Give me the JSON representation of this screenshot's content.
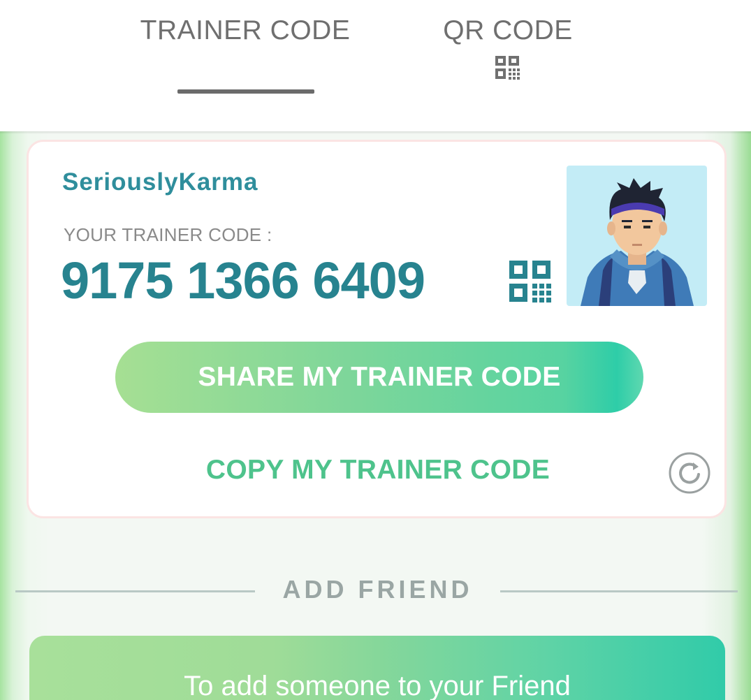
{
  "tabs": [
    {
      "label": "TRAINER CODE",
      "active": true
    },
    {
      "label": "QR CODE",
      "active": false,
      "icon": "qr-code-icon"
    }
  ],
  "trainer_card": {
    "trainer_name": "SeriouslyKarma",
    "code_label": "YOUR TRAINER CODE :",
    "trainer_code": "9175 1366 6409",
    "qr_icon": "qr-code-icon",
    "avatar": "trainer-avatar",
    "share_label": "SHARE MY TRAINER CODE",
    "copy_label": "COPY MY TRAINER CODE",
    "refresh_icon": "refresh-icon"
  },
  "add_friend": {
    "heading": "ADD FRIEND",
    "info_text": "To add someone to your Friend"
  },
  "colors": {
    "code_teal": "#27838f",
    "name_teal": "#2f8e9c",
    "copy_green": "#4ec38c",
    "share_gradient_start": "#a6df93",
    "share_gradient_end": "#2ecda8",
    "card_border": "#fbe4e3"
  }
}
